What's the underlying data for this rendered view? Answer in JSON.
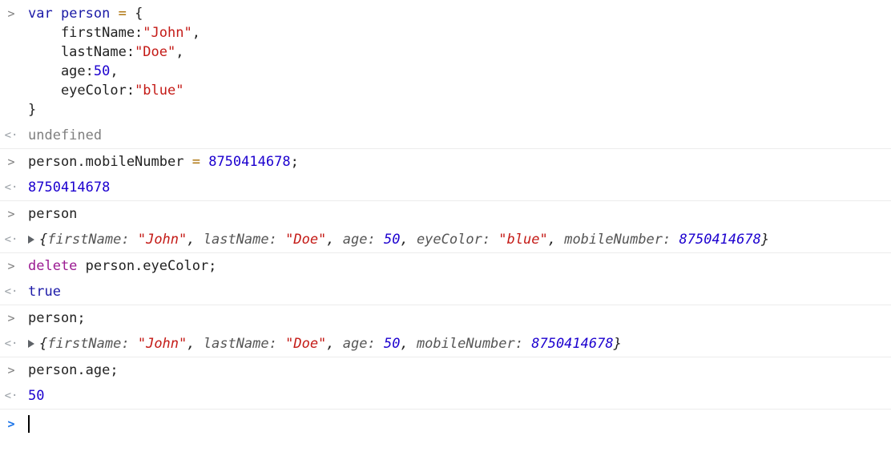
{
  "console": {
    "entries": [
      {
        "kind": "input",
        "lines": [
          {
            "parts": [
              {
                "t": "var",
                "c": "kwb"
              },
              {
                "t": " "
              },
              {
                "t": "person",
                "c": "var"
              },
              {
                "t": " "
              },
              {
                "t": "=",
                "c": "op"
              },
              {
                "t": " {"
              }
            ]
          },
          {
            "parts": [
              {
                "t": "    firstName:"
              },
              {
                "t": "\"John\"",
                "c": "str"
              },
              {
                "t": ","
              }
            ]
          },
          {
            "parts": [
              {
                "t": "    lastName:"
              },
              {
                "t": "\"Doe\"",
                "c": "str"
              },
              {
                "t": ","
              }
            ]
          },
          {
            "parts": [
              {
                "t": "    age:"
              },
              {
                "t": "50",
                "c": "num"
              },
              {
                "t": ","
              }
            ]
          },
          {
            "parts": [
              {
                "t": "    eyeColor:"
              },
              {
                "t": "\"blue\"",
                "c": "str"
              }
            ]
          },
          {
            "parts": [
              {
                "t": "}"
              }
            ]
          }
        ]
      },
      {
        "kind": "result",
        "lines": [
          {
            "parts": [
              {
                "t": "undefined",
                "c": "undef"
              }
            ]
          }
        ]
      },
      {
        "kind": "input",
        "lines": [
          {
            "parts": [
              {
                "t": "person.mobileNumber "
              },
              {
                "t": "=",
                "c": "op"
              },
              {
                "t": " "
              },
              {
                "t": "8750414678",
                "c": "num"
              },
              {
                "t": ";"
              }
            ]
          }
        ]
      },
      {
        "kind": "result",
        "lines": [
          {
            "parts": [
              {
                "t": "8750414678",
                "c": "num"
              }
            ]
          }
        ]
      },
      {
        "kind": "input",
        "lines": [
          {
            "parts": [
              {
                "t": "person"
              }
            ]
          }
        ]
      },
      {
        "kind": "result",
        "expandable": true,
        "lines": [
          {
            "parts": [
              {
                "t": "{",
                "c": "obj"
              },
              {
                "t": "firstName: ",
                "c": "objkey"
              },
              {
                "t": "\"John\"",
                "c": "objstr"
              },
              {
                "t": ", ",
                "c": "obj"
              },
              {
                "t": "lastName: ",
                "c": "objkey"
              },
              {
                "t": "\"Doe\"",
                "c": "objstr"
              },
              {
                "t": ", ",
                "c": "obj"
              },
              {
                "t": "age: ",
                "c": "objkey"
              },
              {
                "t": "50",
                "c": "objnum"
              },
              {
                "t": ", ",
                "c": "obj"
              },
              {
                "t": "eyeColor: ",
                "c": "objkey"
              },
              {
                "t": "\"blue\"",
                "c": "objstr"
              },
              {
                "t": ", ",
                "c": "obj"
              },
              {
                "t": "mobileNumber: ",
                "c": "objkey"
              },
              {
                "t": "8750414678",
                "c": "objnum"
              },
              {
                "t": "}",
                "c": "obj"
              }
            ]
          }
        ]
      },
      {
        "kind": "input",
        "lines": [
          {
            "parts": [
              {
                "t": "delete",
                "c": "kw"
              },
              {
                "t": " person.eyeColor;"
              }
            ]
          }
        ]
      },
      {
        "kind": "result",
        "lines": [
          {
            "parts": [
              {
                "t": "true",
                "c": "kwb"
              }
            ]
          }
        ]
      },
      {
        "kind": "input",
        "lines": [
          {
            "parts": [
              {
                "t": "person;"
              }
            ]
          }
        ]
      },
      {
        "kind": "result",
        "expandable": true,
        "lines": [
          {
            "parts": [
              {
                "t": "{",
                "c": "obj"
              },
              {
                "t": "firstName: ",
                "c": "objkey"
              },
              {
                "t": "\"John\"",
                "c": "objstr"
              },
              {
                "t": ", ",
                "c": "obj"
              },
              {
                "t": "lastName: ",
                "c": "objkey"
              },
              {
                "t": "\"Doe\"",
                "c": "objstr"
              },
              {
                "t": ", ",
                "c": "obj"
              },
              {
                "t": "age: ",
                "c": "objkey"
              },
              {
                "t": "50",
                "c": "objnum"
              },
              {
                "t": ", ",
                "c": "obj"
              },
              {
                "t": "mobileNumber: ",
                "c": "objkey"
              },
              {
                "t": "8750414678",
                "c": "objnum"
              },
              {
                "t": "}",
                "c": "obj"
              }
            ]
          }
        ]
      },
      {
        "kind": "input",
        "lines": [
          {
            "parts": [
              {
                "t": "person.age;"
              }
            ]
          }
        ]
      },
      {
        "kind": "result",
        "lines": [
          {
            "parts": [
              {
                "t": "50",
                "c": "num"
              }
            ]
          }
        ]
      }
    ],
    "prompt_input_icon": "chevron-right-icon",
    "prompt_result_icon": "return-arrow-icon",
    "input_prompt_glyph": ">",
    "result_prompt_glyph": "<·",
    "active_prompt_glyph": ">",
    "colors": {
      "keyword": "#9b1a92",
      "string": "#c41a16",
      "number": "#1c00cf",
      "active_prompt": "#1a73e8"
    }
  }
}
